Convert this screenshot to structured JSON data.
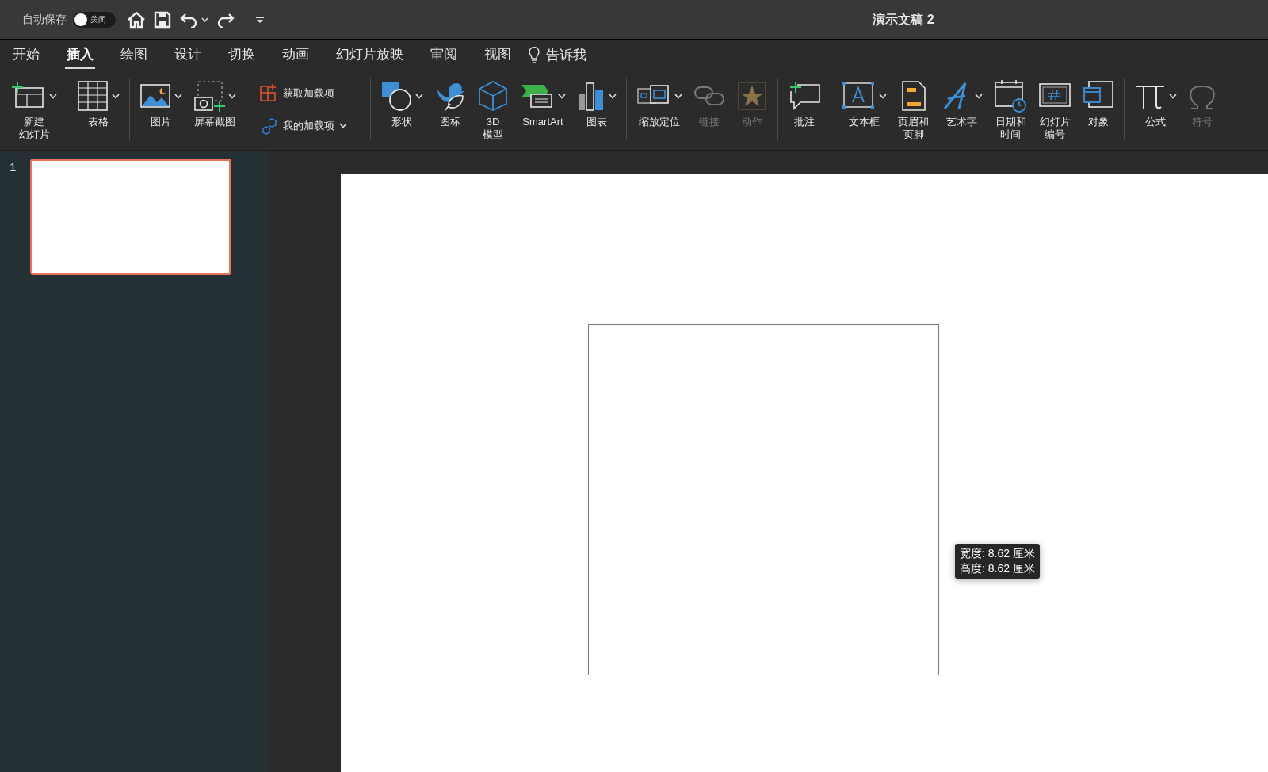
{
  "titlebar": {
    "autosave_label": "自动保存",
    "autosave": {
      "on": false,
      "label": "关闭"
    },
    "title": "演示文稿 2"
  },
  "tabs": [
    {
      "label": "开始",
      "selected": false
    },
    {
      "label": "插入",
      "selected": true
    },
    {
      "label": "绘图",
      "selected": false
    },
    {
      "label": "设计",
      "selected": false
    },
    {
      "label": "切换",
      "selected": false
    },
    {
      "label": "动画",
      "selected": false
    },
    {
      "label": "幻灯片放映",
      "selected": false
    },
    {
      "label": "审阅",
      "selected": false
    },
    {
      "label": "视图",
      "selected": false
    }
  ],
  "tell_me": "告诉我",
  "ribbon": [
    {
      "kind": "large",
      "items": [
        {
          "lines": [
            "新建",
            "幻灯片"
          ],
          "dropdown": true,
          "disabled": false
        }
      ]
    },
    {
      "kind": "large",
      "items": [
        {
          "lines": [
            "表格"
          ],
          "dropdown": true,
          "disabled": false
        }
      ]
    },
    {
      "kind": "large",
      "items": [
        {
          "lines": [
            "图片"
          ],
          "dropdown": true,
          "disabled": false
        },
        {
          "lines": [
            "屏幕截图"
          ],
          "dropdown": true,
          "disabled": false
        }
      ]
    },
    {
      "kind": "stacked",
      "items": [
        {
          "lines": [
            "获取加载项"
          ],
          "dropdown": false,
          "disabled": false
        },
        {
          "lines": [
            "我的加载项"
          ],
          "dropdown": true,
          "disabled": false
        }
      ]
    },
    {
      "kind": "large",
      "items": [
        {
          "lines": [
            "形状"
          ],
          "dropdown": true,
          "disabled": false
        },
        {
          "lines": [
            "图标"
          ],
          "dropdown": false,
          "disabled": false
        },
        {
          "lines": [
            "3D",
            "模型"
          ],
          "dropdown": false,
          "disabled": false
        },
        {
          "lines": [
            "SmartArt"
          ],
          "dropdown": true,
          "disabled": false
        },
        {
          "lines": [
            "图表"
          ],
          "dropdown": true,
          "disabled": false
        }
      ]
    },
    {
      "kind": "large",
      "items": [
        {
          "lines": [
            "缩放定位"
          ],
          "dropdown": true,
          "disabled": false
        },
        {
          "lines": [
            "链接"
          ],
          "dropdown": false,
          "disabled": true
        },
        {
          "lines": [
            "动作"
          ],
          "dropdown": false,
          "disabled": true
        }
      ]
    },
    {
      "kind": "large",
      "items": [
        {
          "lines": [
            "批注"
          ],
          "dropdown": false,
          "disabled": false
        }
      ]
    },
    {
      "kind": "large",
      "items": [
        {
          "lines": [
            "文本框"
          ],
          "dropdown": true,
          "disabled": false
        },
        {
          "lines": [
            "页眉和",
            "页脚"
          ],
          "dropdown": false,
          "disabled": false
        },
        {
          "lines": [
            "艺术字"
          ],
          "dropdown": true,
          "disabled": false
        },
        {
          "lines": [
            "日期和",
            "时间"
          ],
          "dropdown": false,
          "disabled": false
        },
        {
          "lines": [
            "幻灯片",
            "编号"
          ],
          "dropdown": false,
          "disabled": false
        },
        {
          "lines": [
            "对象"
          ],
          "dropdown": false,
          "disabled": false
        }
      ]
    },
    {
      "kind": "large",
      "items": [
        {
          "lines": [
            "公式"
          ],
          "dropdown": true,
          "disabled": false
        },
        {
          "lines": [
            "符号"
          ],
          "dropdown": false,
          "disabled": true
        }
      ]
    }
  ],
  "thumbnails": [
    {
      "number": "1",
      "selected": true
    }
  ],
  "tooltip": {
    "lines": [
      "宽度: 8.62 厘米",
      "高度: 8.62 厘米"
    ]
  }
}
